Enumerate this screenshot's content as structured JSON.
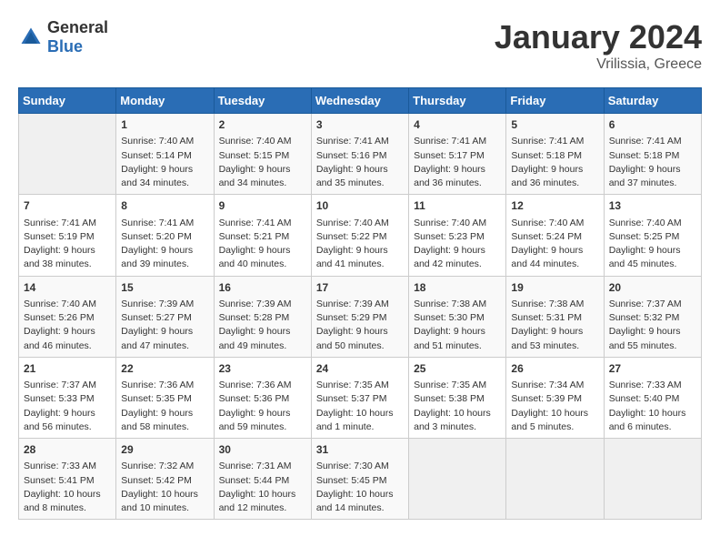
{
  "header": {
    "logo_general": "General",
    "logo_blue": "Blue",
    "month": "January 2024",
    "location": "Vrilissia, Greece"
  },
  "days_of_week": [
    "Sunday",
    "Monday",
    "Tuesday",
    "Wednesday",
    "Thursday",
    "Friday",
    "Saturday"
  ],
  "weeks": [
    [
      {
        "day": "",
        "empty": true
      },
      {
        "day": "1",
        "sunrise": "Sunrise: 7:40 AM",
        "sunset": "Sunset: 5:14 PM",
        "daylight": "Daylight: 9 hours and 34 minutes."
      },
      {
        "day": "2",
        "sunrise": "Sunrise: 7:40 AM",
        "sunset": "Sunset: 5:15 PM",
        "daylight": "Daylight: 9 hours and 34 minutes."
      },
      {
        "day": "3",
        "sunrise": "Sunrise: 7:41 AM",
        "sunset": "Sunset: 5:16 PM",
        "daylight": "Daylight: 9 hours and 35 minutes."
      },
      {
        "day": "4",
        "sunrise": "Sunrise: 7:41 AM",
        "sunset": "Sunset: 5:17 PM",
        "daylight": "Daylight: 9 hours and 36 minutes."
      },
      {
        "day": "5",
        "sunrise": "Sunrise: 7:41 AM",
        "sunset": "Sunset: 5:18 PM",
        "daylight": "Daylight: 9 hours and 36 minutes."
      },
      {
        "day": "6",
        "sunrise": "Sunrise: 7:41 AM",
        "sunset": "Sunset: 5:18 PM",
        "daylight": "Daylight: 9 hours and 37 minutes."
      }
    ],
    [
      {
        "day": "7",
        "sunrise": "Sunrise: 7:41 AM",
        "sunset": "Sunset: 5:19 PM",
        "daylight": "Daylight: 9 hours and 38 minutes."
      },
      {
        "day": "8",
        "sunrise": "Sunrise: 7:41 AM",
        "sunset": "Sunset: 5:20 PM",
        "daylight": "Daylight: 9 hours and 39 minutes."
      },
      {
        "day": "9",
        "sunrise": "Sunrise: 7:41 AM",
        "sunset": "Sunset: 5:21 PM",
        "daylight": "Daylight: 9 hours and 40 minutes."
      },
      {
        "day": "10",
        "sunrise": "Sunrise: 7:40 AM",
        "sunset": "Sunset: 5:22 PM",
        "daylight": "Daylight: 9 hours and 41 minutes."
      },
      {
        "day": "11",
        "sunrise": "Sunrise: 7:40 AM",
        "sunset": "Sunset: 5:23 PM",
        "daylight": "Daylight: 9 hours and 42 minutes."
      },
      {
        "day": "12",
        "sunrise": "Sunrise: 7:40 AM",
        "sunset": "Sunset: 5:24 PM",
        "daylight": "Daylight: 9 hours and 44 minutes."
      },
      {
        "day": "13",
        "sunrise": "Sunrise: 7:40 AM",
        "sunset": "Sunset: 5:25 PM",
        "daylight": "Daylight: 9 hours and 45 minutes."
      }
    ],
    [
      {
        "day": "14",
        "sunrise": "Sunrise: 7:40 AM",
        "sunset": "Sunset: 5:26 PM",
        "daylight": "Daylight: 9 hours and 46 minutes."
      },
      {
        "day": "15",
        "sunrise": "Sunrise: 7:39 AM",
        "sunset": "Sunset: 5:27 PM",
        "daylight": "Daylight: 9 hours and 47 minutes."
      },
      {
        "day": "16",
        "sunrise": "Sunrise: 7:39 AM",
        "sunset": "Sunset: 5:28 PM",
        "daylight": "Daylight: 9 hours and 49 minutes."
      },
      {
        "day": "17",
        "sunrise": "Sunrise: 7:39 AM",
        "sunset": "Sunset: 5:29 PM",
        "daylight": "Daylight: 9 hours and 50 minutes."
      },
      {
        "day": "18",
        "sunrise": "Sunrise: 7:38 AM",
        "sunset": "Sunset: 5:30 PM",
        "daylight": "Daylight: 9 hours and 51 minutes."
      },
      {
        "day": "19",
        "sunrise": "Sunrise: 7:38 AM",
        "sunset": "Sunset: 5:31 PM",
        "daylight": "Daylight: 9 hours and 53 minutes."
      },
      {
        "day": "20",
        "sunrise": "Sunrise: 7:37 AM",
        "sunset": "Sunset: 5:32 PM",
        "daylight": "Daylight: 9 hours and 55 minutes."
      }
    ],
    [
      {
        "day": "21",
        "sunrise": "Sunrise: 7:37 AM",
        "sunset": "Sunset: 5:33 PM",
        "daylight": "Daylight: 9 hours and 56 minutes."
      },
      {
        "day": "22",
        "sunrise": "Sunrise: 7:36 AM",
        "sunset": "Sunset: 5:35 PM",
        "daylight": "Daylight: 9 hours and 58 minutes."
      },
      {
        "day": "23",
        "sunrise": "Sunrise: 7:36 AM",
        "sunset": "Sunset: 5:36 PM",
        "daylight": "Daylight: 9 hours and 59 minutes."
      },
      {
        "day": "24",
        "sunrise": "Sunrise: 7:35 AM",
        "sunset": "Sunset: 5:37 PM",
        "daylight": "Daylight: 10 hours and 1 minute."
      },
      {
        "day": "25",
        "sunrise": "Sunrise: 7:35 AM",
        "sunset": "Sunset: 5:38 PM",
        "daylight": "Daylight: 10 hours and 3 minutes."
      },
      {
        "day": "26",
        "sunrise": "Sunrise: 7:34 AM",
        "sunset": "Sunset: 5:39 PM",
        "daylight": "Daylight: 10 hours and 5 minutes."
      },
      {
        "day": "27",
        "sunrise": "Sunrise: 7:33 AM",
        "sunset": "Sunset: 5:40 PM",
        "daylight": "Daylight: 10 hours and 6 minutes."
      }
    ],
    [
      {
        "day": "28",
        "sunrise": "Sunrise: 7:33 AM",
        "sunset": "Sunset: 5:41 PM",
        "daylight": "Daylight: 10 hours and 8 minutes."
      },
      {
        "day": "29",
        "sunrise": "Sunrise: 7:32 AM",
        "sunset": "Sunset: 5:42 PM",
        "daylight": "Daylight: 10 hours and 10 minutes."
      },
      {
        "day": "30",
        "sunrise": "Sunrise: 7:31 AM",
        "sunset": "Sunset: 5:44 PM",
        "daylight": "Daylight: 10 hours and 12 minutes."
      },
      {
        "day": "31",
        "sunrise": "Sunrise: 7:30 AM",
        "sunset": "Sunset: 5:45 PM",
        "daylight": "Daylight: 10 hours and 14 minutes."
      },
      {
        "day": "",
        "empty": true
      },
      {
        "day": "",
        "empty": true
      },
      {
        "day": "",
        "empty": true
      }
    ]
  ]
}
